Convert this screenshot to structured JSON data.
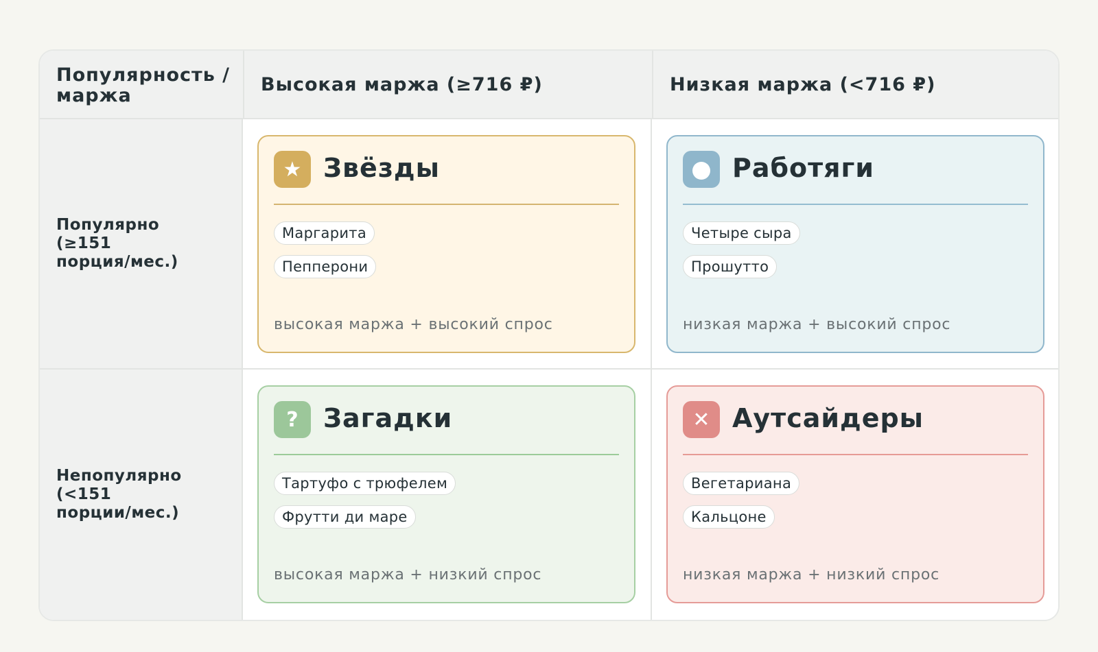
{
  "header": {
    "corner": "Популярность / маржа",
    "col_high": "Высокая маржа (≥716 ₽)",
    "col_low": "Низкая маржа (<716 ₽)"
  },
  "rows": [
    {
      "label": "Популярно\n(≥151\nпорция/мес.)"
    },
    {
      "label": "Непопулярно\n(<151\nпорции/мес.)"
    }
  ],
  "quadrants": [
    {
      "title": "Звёзды",
      "icon": "star-icon",
      "items": [
        "Маргарита",
        "Пепперони"
      ],
      "note": "высокая маржа + высокий спрос",
      "color": "#d4ae5e"
    },
    {
      "title": "Работяги",
      "icon": "circle-icon",
      "items": [
        "Четыре сыра",
        "Прошутто"
      ],
      "note": "низкая маржа + высокий спрос",
      "color": "#8fb6cb"
    },
    {
      "title": "Загадки",
      "icon": "question-icon",
      "items": [
        "Тартуфо с трюфелем",
        "Фрутти ди маре"
      ],
      "note": "высокая маржа + низкий спрос",
      "color": "#9cc79a"
    },
    {
      "title": "Аутсайдеры",
      "icon": "cross-icon",
      "items": [
        "Вегетариана",
        "Кальцоне"
      ],
      "note": "низкая маржа + низкий спрос",
      "color": "#e08c88"
    }
  ]
}
